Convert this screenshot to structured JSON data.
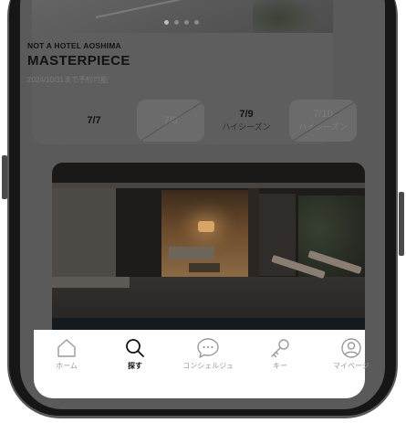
{
  "listing": {
    "hotel_name": "NOT A HOTEL AOSHIMA",
    "room_name": "MASTERPIECE",
    "availability_note": "2024/10/31まで予約可能",
    "carousel_dots": 4,
    "dates": [
      {
        "date": "7/7",
        "subtitle": "",
        "available": true
      },
      {
        "date": "7/8",
        "subtitle": "",
        "available": false
      },
      {
        "date": "7/9",
        "subtitle": "ハイシーズン",
        "available": true
      },
      {
        "date": "7/10",
        "subtitle": "ハイシーズン",
        "available": false
      }
    ]
  },
  "tabbar": {
    "items": [
      {
        "label": "ホーム",
        "icon": "home-icon",
        "active": false
      },
      {
        "label": "探す",
        "icon": "search-icon",
        "active": true
      },
      {
        "label": "コンシェルジュ",
        "icon": "chat-bubble-icon",
        "active": false
      },
      {
        "label": "キー",
        "icon": "key-icon",
        "active": false
      },
      {
        "label": "マイページ",
        "icon": "user-icon",
        "active": false
      }
    ]
  },
  "colors": {
    "overlay": "#5a5a5a",
    "active_text": "#111111",
    "inactive_text": "#9a9a9a",
    "tabbar_bg": "#ffffff"
  }
}
